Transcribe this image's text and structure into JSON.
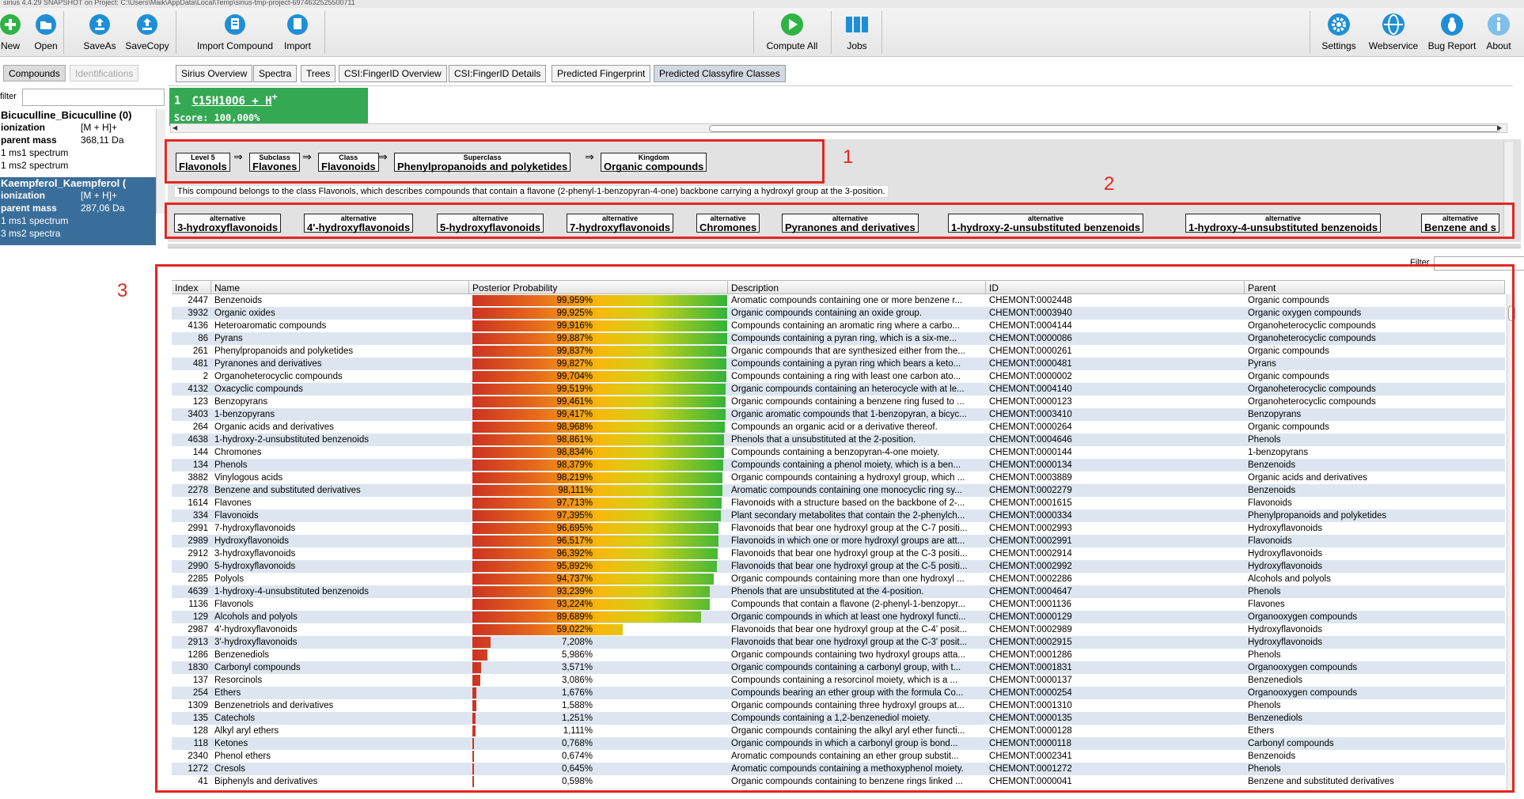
{
  "titlebar": {
    "text": "sirius 4.4.29 SNAPSHOT on Project: C:\\Users\\Maik\\AppData\\Local\\Temp\\sirius-tmp-project-6974632525500711"
  },
  "toolbar": {
    "new_label": "New",
    "open_label": "Open",
    "saveas_label": "SaveAs",
    "savecopy_label": "SaveCopy",
    "import_compound_label": "Import Compound",
    "import_label": "Import",
    "compute_all_label": "Compute All",
    "jobs_label": "Jobs",
    "settings_label": "Settings",
    "webservice_label": "Webservice",
    "bugreport_label": "Bug Report",
    "about_label": "About",
    "accent_green": "#2fb345",
    "accent_blue": "#1f8fd5"
  },
  "left_tabs": {
    "compounds": "Compounds",
    "identifications": "Identifications"
  },
  "left_filter": {
    "label": "filter"
  },
  "compounds": [
    {
      "name": "Bicuculline_Bicuculline (0)",
      "ionization_label": "ionization",
      "ionization": "[M + H]+",
      "mass_label": "parent mass",
      "mass": "368,11 Da",
      "ms1": "1 ms1 spectrum",
      "ms2": "1 ms2 spectrum"
    },
    {
      "name": "Kaempferol_Kaempferol (",
      "ionization_label": "ionization",
      "ionization": "[M + H]+",
      "mass_label": "parent mass",
      "mass": "287,06 Da",
      "ms1": "1 ms1 spectrum",
      "ms2": "3 ms2 spectra"
    }
  ],
  "main_tabs": [
    "Sirius Overview",
    "Spectra",
    "Trees",
    "CSI:FingerID Overview",
    "CSI:FingerID Details",
    "Predicted Fingerprint",
    "Predicted Classyfire Classes"
  ],
  "formula": {
    "rank": "1",
    "formula": "C15H10O6 + H",
    "charge": "+",
    "score": "Score: 100,000%"
  },
  "hierarchy": [
    {
      "cap": "Level 5",
      "val": "Flavonols"
    },
    {
      "cap": "Subclass",
      "val": "Flavones"
    },
    {
      "cap": "Class",
      "val": "Flavonoids"
    },
    {
      "cap": "Superclass",
      "val": "Phenylpropanoids and polyketides"
    },
    {
      "cap": "Kingdom",
      "val": "Organic compounds"
    }
  ],
  "arrow_glyph": "⇒",
  "description": "This compound belongs to the class Flavonols, which describes compounds that contain a flavone (2-phenyl-1-benzopyran-4-one) backbone carrying a hydroxyl group at the 3-position.",
  "alternatives_caption": "alternative",
  "alternatives": [
    "3-hydroxyflavonoids",
    "4'-hydroxyflavonoids",
    "5-hydroxyflavonoids",
    "7-hydroxyflavonoids",
    "Chromones",
    "Pyranones and derivatives",
    "1-hydroxy-2-unsubstituted benzenoids",
    "1-hydroxy-4-unsubstituted benzenoids",
    "Benzene and s"
  ],
  "annotations": [
    "1",
    "2",
    "3"
  ],
  "table_filter": {
    "label": "Filter"
  },
  "table": {
    "headers": [
      "Index",
      "Name",
      "Posterior Probability",
      "Description",
      "ID",
      "Parent"
    ],
    "rows": [
      {
        "index": "2447",
        "name": "Benzenoids",
        "prob": 99.959,
        "prob_text": "99,959%",
        "desc": "Aromatic compounds containing one or more benzene r...",
        "id": "CHEMONT:0002448",
        "parent": "Organic compounds"
      },
      {
        "index": "3932",
        "name": "Organic oxides",
        "prob": 99.925,
        "prob_text": "99,925%",
        "desc": "Organic compounds containing an oxide group.",
        "id": "CHEMONT:0003940",
        "parent": "Organic oxygen compounds"
      },
      {
        "index": "4136",
        "name": "Heteroaromatic compounds",
        "prob": 99.916,
        "prob_text": "99,916%",
        "desc": "Compounds containing an aromatic ring where a carbo...",
        "id": "CHEMONT:0004144",
        "parent": "Organoheterocyclic compounds"
      },
      {
        "index": "86",
        "name": "Pyrans",
        "prob": 99.887,
        "prob_text": "99,887%",
        "desc": "Compounds containing a pyran ring, which is a six-me...",
        "id": "CHEMONT:0000086",
        "parent": "Organoheterocyclic compounds"
      },
      {
        "index": "261",
        "name": "Phenylpropanoids and polyketides",
        "prob": 99.837,
        "prob_text": "99,837%",
        "desc": "Organic compounds that are synthesized either from the...",
        "id": "CHEMONT:0000261",
        "parent": "Organic compounds"
      },
      {
        "index": "481",
        "name": "Pyranones and derivatives",
        "prob": 99.827,
        "prob_text": "99,827%",
        "desc": "Compounds containing a pyran ring which bears a keto...",
        "id": "CHEMONT:0000481",
        "parent": "Pyrans"
      },
      {
        "index": "2",
        "name": "Organoheterocyclic compounds",
        "prob": 99.704,
        "prob_text": "99,704%",
        "desc": "Compounds containing a ring with least one carbon ato...",
        "id": "CHEMONT:0000002",
        "parent": "Organic compounds"
      },
      {
        "index": "4132",
        "name": "Oxacyclic compounds",
        "prob": 99.519,
        "prob_text": "99,519%",
        "desc": "Organic compounds containing an heterocycle with at le...",
        "id": "CHEMONT:0004140",
        "parent": "Organoheterocyclic compounds"
      },
      {
        "index": "123",
        "name": "Benzopyrans",
        "prob": 99.461,
        "prob_text": "99,461%",
        "desc": "Organic compounds containing a benzene ring fused to ...",
        "id": "CHEMONT:0000123",
        "parent": "Organoheterocyclic compounds"
      },
      {
        "index": "3403",
        "name": "1-benzopyrans",
        "prob": 99.417,
        "prob_text": "99,417%",
        "desc": "Organic aromatic compounds that 1-benzopyran, a bicyc...",
        "id": "CHEMONT:0003410",
        "parent": "Benzopyrans"
      },
      {
        "index": "264",
        "name": "Organic acids and derivatives",
        "prob": 98.968,
        "prob_text": "98,968%",
        "desc": "Compounds an organic acid or a derivative thereof.",
        "id": "CHEMONT:0000264",
        "parent": "Organic compounds"
      },
      {
        "index": "4638",
        "name": "1-hydroxy-2-unsubstituted benzenoids",
        "prob": 98.861,
        "prob_text": "98,861%",
        "desc": "Phenols that a unsubstituted at the 2-position.",
        "id": "CHEMONT:0004646",
        "parent": "Phenols"
      },
      {
        "index": "144",
        "name": "Chromones",
        "prob": 98.834,
        "prob_text": "98,834%",
        "desc": "Compounds containing a benzopyran-4-one moiety.",
        "id": "CHEMONT:0000144",
        "parent": "1-benzopyrans"
      },
      {
        "index": "134",
        "name": "Phenols",
        "prob": 98.379,
        "prob_text": "98,379%",
        "desc": "Compounds containing a phenol moiety, which is a ben...",
        "id": "CHEMONT:0000134",
        "parent": "Benzenoids"
      },
      {
        "index": "3882",
        "name": "Vinylogous acids",
        "prob": 98.219,
        "prob_text": "98,219%",
        "desc": "Organic compounds containing a hydroxyl group, which ...",
        "id": "CHEMONT:0003889",
        "parent": "Organic acids and derivatives"
      },
      {
        "index": "2278",
        "name": "Benzene and substituted derivatives",
        "prob": 98.111,
        "prob_text": "98,111%",
        "desc": "Aromatic compounds containing one monocyclic ring sy...",
        "id": "CHEMONT:0002279",
        "parent": "Benzenoids"
      },
      {
        "index": "1614",
        "name": "Flavones",
        "prob": 97.713,
        "prob_text": "97,713%",
        "desc": "Flavonoids with a structure based on the backbone of 2-...",
        "id": "CHEMONT:0001615",
        "parent": "Flavonoids"
      },
      {
        "index": "334",
        "name": "Flavonoids",
        "prob": 97.395,
        "prob_text": "97,395%",
        "desc": "Plant secondary metabolites that contain the 2-phenylch...",
        "id": "CHEMONT:0000334",
        "parent": "Phenylpropanoids and polyketides"
      },
      {
        "index": "2991",
        "name": "7-hydroxyflavonoids",
        "prob": 96.695,
        "prob_text": "96,695%",
        "desc": "Flavonoids that bear one hydroxyl group at the C-7 positi...",
        "id": "CHEMONT:0002993",
        "parent": "Hydroxyflavonoids"
      },
      {
        "index": "2989",
        "name": "Hydroxyflavonoids",
        "prob": 96.517,
        "prob_text": "96,517%",
        "desc": "Flavonoids in which one or more hydroxyl groups are att...",
        "id": "CHEMONT:0002991",
        "parent": "Flavonoids"
      },
      {
        "index": "2912",
        "name": "3-hydroxyflavonoids",
        "prob": 96.392,
        "prob_text": "96,392%",
        "desc": "Flavonoids that bear one hydroxyl group at the C-3 positi...",
        "id": "CHEMONT:0002914",
        "parent": "Hydroxyflavonoids"
      },
      {
        "index": "2990",
        "name": "5-hydroxyflavonoids",
        "prob": 95.892,
        "prob_text": "95,892%",
        "desc": "Flavonoids that bear one hydroxyl group at the C-5 positi...",
        "id": "CHEMONT:0002992",
        "parent": "Hydroxyflavonoids"
      },
      {
        "index": "2285",
        "name": "Polyols",
        "prob": 94.737,
        "prob_text": "94,737%",
        "desc": "Organic compounds containing more than one hydroxyl ...",
        "id": "CHEMONT:0002286",
        "parent": "Alcohols and polyols"
      },
      {
        "index": "4639",
        "name": "1-hydroxy-4-unsubstituted benzenoids",
        "prob": 93.239,
        "prob_text": "93,239%",
        "desc": "Phenols that are unsubstituted at the 4-position.",
        "id": "CHEMONT:0004647",
        "parent": "Phenols"
      },
      {
        "index": "1136",
        "name": "Flavonols",
        "prob": 93.224,
        "prob_text": "93,224%",
        "desc": "Compounds that contain a flavone (2-phenyl-1-benzopyr...",
        "id": "CHEMONT:0001136",
        "parent": "Flavones"
      },
      {
        "index": "129",
        "name": "Alcohols and polyols",
        "prob": 89.689,
        "prob_text": "89,689%",
        "desc": "Organic compounds in which at least one hydroxyl functi...",
        "id": "CHEMONT:0000129",
        "parent": "Organooxygen compounds"
      },
      {
        "index": "2987",
        "name": "4'-hydroxyflavonoids",
        "prob": 59.022,
        "prob_text": "59,022%",
        "desc": "Flavonoids that bear one hydroxyl group at the C-4' posit...",
        "id": "CHEMONT:0002989",
        "parent": "Hydroxyflavonoids"
      },
      {
        "index": "2913",
        "name": "3'-hydroxyflavonoids",
        "prob": 7.208,
        "prob_text": "7,208%",
        "desc": "Flavonoids that bear one hydroxyl group at the C-3' posit...",
        "id": "CHEMONT:0002915",
        "parent": "Hydroxyflavonoids"
      },
      {
        "index": "1286",
        "name": "Benzenediols",
        "prob": 5.986,
        "prob_text": "5,986%",
        "desc": "Organic compounds containing two hydroxyl groups atta...",
        "id": "CHEMONT:0001286",
        "parent": "Phenols"
      },
      {
        "index": "1830",
        "name": "Carbonyl compounds",
        "prob": 3.571,
        "prob_text": "3,571%",
        "desc": "Organic compounds containing a carbonyl group, with t...",
        "id": "CHEMONT:0001831",
        "parent": "Organooxygen compounds"
      },
      {
        "index": "137",
        "name": "Resorcinols",
        "prob": 3.086,
        "prob_text": "3,086%",
        "desc": "Compounds containing a resorcinol moiety, which is a ...",
        "id": "CHEMONT:0000137",
        "parent": "Benzenediols"
      },
      {
        "index": "254",
        "name": "Ethers",
        "prob": 1.676,
        "prob_text": "1,676%",
        "desc": "Compounds bearing an ether group with the formula Co...",
        "id": "CHEMONT:0000254",
        "parent": "Organooxygen compounds"
      },
      {
        "index": "1309",
        "name": "Benzenetriols and derivatives",
        "prob": 1.588,
        "prob_text": "1,588%",
        "desc": "Organic compounds containing three hydroxyl groups at...",
        "id": "CHEMONT:0001310",
        "parent": "Phenols"
      },
      {
        "index": "135",
        "name": "Catechols",
        "prob": 1.251,
        "prob_text": "1,251%",
        "desc": "Compounds containing a 1,2-benzenediol moiety.",
        "id": "CHEMONT:0000135",
        "parent": "Benzenediols"
      },
      {
        "index": "128",
        "name": "Alkyl aryl ethers",
        "prob": 1.111,
        "prob_text": "1,111%",
        "desc": "Organic compounds containing the alkyl aryl ether functi...",
        "id": "CHEMONT:0000128",
        "parent": "Ethers"
      },
      {
        "index": "118",
        "name": "Ketones",
        "prob": 0.768,
        "prob_text": "0,768%",
        "desc": "Organic compounds  in which a carbonyl group is bond...",
        "id": "CHEMONT:0000118",
        "parent": "Carbonyl compounds"
      },
      {
        "index": "2340",
        "name": "Phenol ethers",
        "prob": 0.674,
        "prob_text": "0,674%",
        "desc": "Aromatic compounds containing an ether group substit...",
        "id": "CHEMONT:0002341",
        "parent": "Benzenoids"
      },
      {
        "index": "1272",
        "name": "Cresols",
        "prob": 0.645,
        "prob_text": "0,645%",
        "desc": "Aromatic compounds containing a methoxyphenol moiety.",
        "id": "CHEMONT:0001272",
        "parent": "Phenols"
      },
      {
        "index": "41",
        "name": "Biphenyls and derivatives",
        "prob": 0.598,
        "prob_text": "0,598%",
        "desc": "Organic compounds containing to benzene rings linked ...",
        "id": "CHEMONT:0000041",
        "parent": "Benzene and substituted derivatives"
      }
    ]
  }
}
